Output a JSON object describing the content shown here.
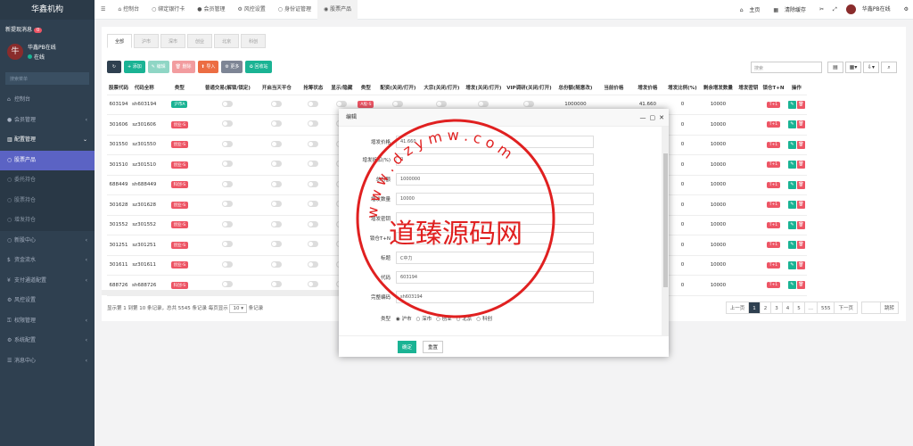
{
  "sidebar": {
    "brand": "华鑫机构",
    "new_msg": "新提现消息",
    "new_msg_count": "0",
    "user_name": "华鑫PB在线",
    "user_status": "在线",
    "search_placeholder": "搜索菜单",
    "items": [
      {
        "label": "控制台",
        "icon": "dashboard-icon"
      },
      {
        "label": "会员管理",
        "icon": "user-icon"
      },
      {
        "label": "配置管理",
        "icon": "bank-icon"
      },
      {
        "label": "股票产品",
        "icon": "circle-icon"
      },
      {
        "label": "委托持仓",
        "icon": "circle-icon"
      },
      {
        "label": "股票持仓",
        "icon": "circle-icon"
      },
      {
        "label": "增发持仓",
        "icon": "circle-icon"
      },
      {
        "label": "新股中心",
        "icon": "circle-icon"
      },
      {
        "label": "资金流水",
        "icon": "dollar-icon"
      },
      {
        "label": "支付通道配置",
        "icon": "yen-icon"
      },
      {
        "label": "风控设置",
        "icon": "gear-icon"
      },
      {
        "label": "权限管理",
        "icon": "key-icon"
      },
      {
        "label": "系统配置",
        "icon": "cog-icon"
      },
      {
        "label": "消息中心",
        "icon": "list-icon"
      }
    ]
  },
  "topbar": {
    "tabs": [
      "控制台",
      "绑定银行卡",
      "会员管理",
      "风控设置",
      "身份证管理",
      "股票产品"
    ],
    "home": "主页",
    "clear_cache": "清除缓存",
    "user": "华鑫PB在线"
  },
  "panel": {
    "subtabs": [
      "全部",
      "沪市",
      "深市",
      "创业",
      "北京",
      "科创"
    ],
    "toolbar": [
      "添加",
      "编辑",
      "删除",
      "导入",
      "更多",
      "回收站"
    ],
    "search_placeholder": "搜索",
    "columns": [
      "股票代码",
      "代码全称",
      "类型",
      "普通交易(解锁/锁定)",
      "开启当天平仓",
      "抢筹状态",
      "显示/隐藏",
      "类型",
      "配资(关闭/打开)",
      "大宗(关闭/打开)",
      "增发(关闭/打开)",
      "VIP调研(关闭/打开)",
      "总份额(随意改)",
      "当前价格",
      "增发价格",
      "增发比例(%)",
      "剩余增发数量",
      "增发密钥",
      "锁仓T+N",
      "操作"
    ],
    "rows": [
      {
        "code": "603194",
        "full": "sh603194",
        "type": "沪市A",
        "tag2": "A股-S",
        "total": "1000000",
        "price": "",
        "issue_price": "41.660",
        "ratio": "0",
        "remain": "10000",
        "lock": "T+1"
      },
      {
        "code": "301606",
        "full": "sz301606",
        "type": "创业-S",
        "tag2": "",
        "total": "",
        "price": "",
        "issue_price": "40.380",
        "ratio": "0",
        "remain": "10000",
        "lock": "T+1"
      },
      {
        "code": "301550",
        "full": "sz301550",
        "type": "创业-S",
        "tag2": "",
        "total": "",
        "price": "",
        "issue_price": "78.260",
        "ratio": "0",
        "remain": "10000",
        "lock": "T+1"
      },
      {
        "code": "301510",
        "full": "sz301510",
        "type": "创业-S",
        "tag2": "",
        "total": "",
        "price": "",
        "issue_price": "27.170",
        "ratio": "0",
        "remain": "10000",
        "lock": "T+1"
      },
      {
        "code": "688449",
        "full": "sh688449",
        "type": "科创-S",
        "tag2": "",
        "total": "",
        "price": "",
        "issue_price": "43.750",
        "ratio": "0",
        "remain": "10000",
        "lock": "T+1"
      },
      {
        "code": "301628",
        "full": "sz301628",
        "type": "创业-S",
        "tag2": "",
        "total": "",
        "price": "",
        "issue_price": "63.510",
        "ratio": "0",
        "remain": "10000",
        "lock": "T+1"
      },
      {
        "code": "301552",
        "full": "sz301552",
        "type": "创业-S",
        "tag2": "",
        "total": "",
        "price": "",
        "issue_price": "57.990",
        "ratio": "0",
        "remain": "10000",
        "lock": "T+1"
      },
      {
        "code": "301251",
        "full": "sz301251",
        "type": "创业-S",
        "tag2": "",
        "total": "",
        "price": "",
        "issue_price": "38.570",
        "ratio": "0",
        "remain": "10000",
        "lock": "T+1"
      },
      {
        "code": "301611",
        "full": "sz301611",
        "type": "创业-S",
        "tag2": "",
        "total": "",
        "price": "",
        "issue_price": "61.080",
        "ratio": "0",
        "remain": "10000",
        "lock": "T+1"
      },
      {
        "code": "688726",
        "full": "sh688726",
        "type": "科创-S",
        "tag2": "",
        "total": "",
        "price": "",
        "issue_price": "47.600",
        "ratio": "0",
        "remain": "10000",
        "lock": "T+1"
      }
    ],
    "pagination_info": "显示第 1 到第 10 条记录，总共 5545 条记录 每页显示",
    "page_size": "10",
    "page_size_suffix": "条记录",
    "pages": [
      "上一页",
      "1",
      "2",
      "3",
      "4",
      "5",
      "...",
      "555",
      "下一页"
    ],
    "go": "跳转"
  },
  "modal": {
    "title": "编辑",
    "fields": [
      {
        "label": "增发价格",
        "value": "41.660"
      },
      {
        "label": "增发折扣(%)",
        "value": "0"
      },
      {
        "label": "总份额",
        "value": "1000000"
      },
      {
        "label": "增发数量",
        "value": "10000"
      },
      {
        "label": "增发密钥",
        "value": ""
      },
      {
        "label": "锁仓T+N",
        "value": ""
      },
      {
        "label": "标题",
        "value": "C中力"
      },
      {
        "label": "代码",
        "value": "603194"
      },
      {
        "label": "完整编码",
        "value": "sh603194"
      }
    ],
    "type_label": "类型",
    "type_options": [
      "沪市",
      "深市",
      "创业",
      "北京",
      "科创"
    ],
    "ok": "确定",
    "reset": "重置"
  },
  "watermark": {
    "center_text": "道臻源码网",
    "ring_text": "w w w . d z y m w . c o m"
  }
}
